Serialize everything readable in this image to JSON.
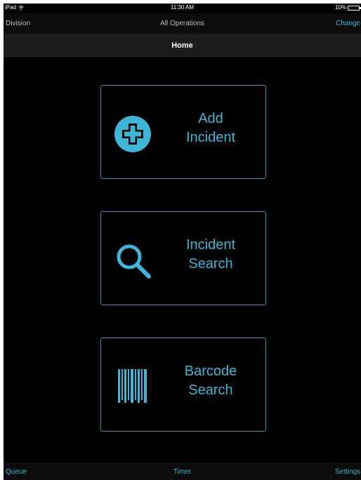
{
  "status_bar": {
    "device": "iPad",
    "time": "11:30 AM",
    "battery": "10%",
    "battery_level": 0.1
  },
  "division_bar": {
    "label": "Division",
    "value": "All Operations",
    "change_label": "Change"
  },
  "nav": {
    "title": "Home"
  },
  "tiles": [
    {
      "line1": "Add",
      "line2": "Incident",
      "icon": "plus-circle-icon"
    },
    {
      "line1": "Incident",
      "line2": "Search",
      "icon": "magnifier-icon"
    },
    {
      "line1": "Barcode",
      "line2": "Search",
      "icon": "barcode-icon"
    }
  ],
  "bottom_bar": {
    "queue": "Queue",
    "timer": "Timer",
    "settings": "Settings"
  },
  "colors": {
    "accent": "#3fb6d8",
    "tile_border": "#3a93b0",
    "background": "#000000",
    "battery_low": "#e2303c"
  }
}
